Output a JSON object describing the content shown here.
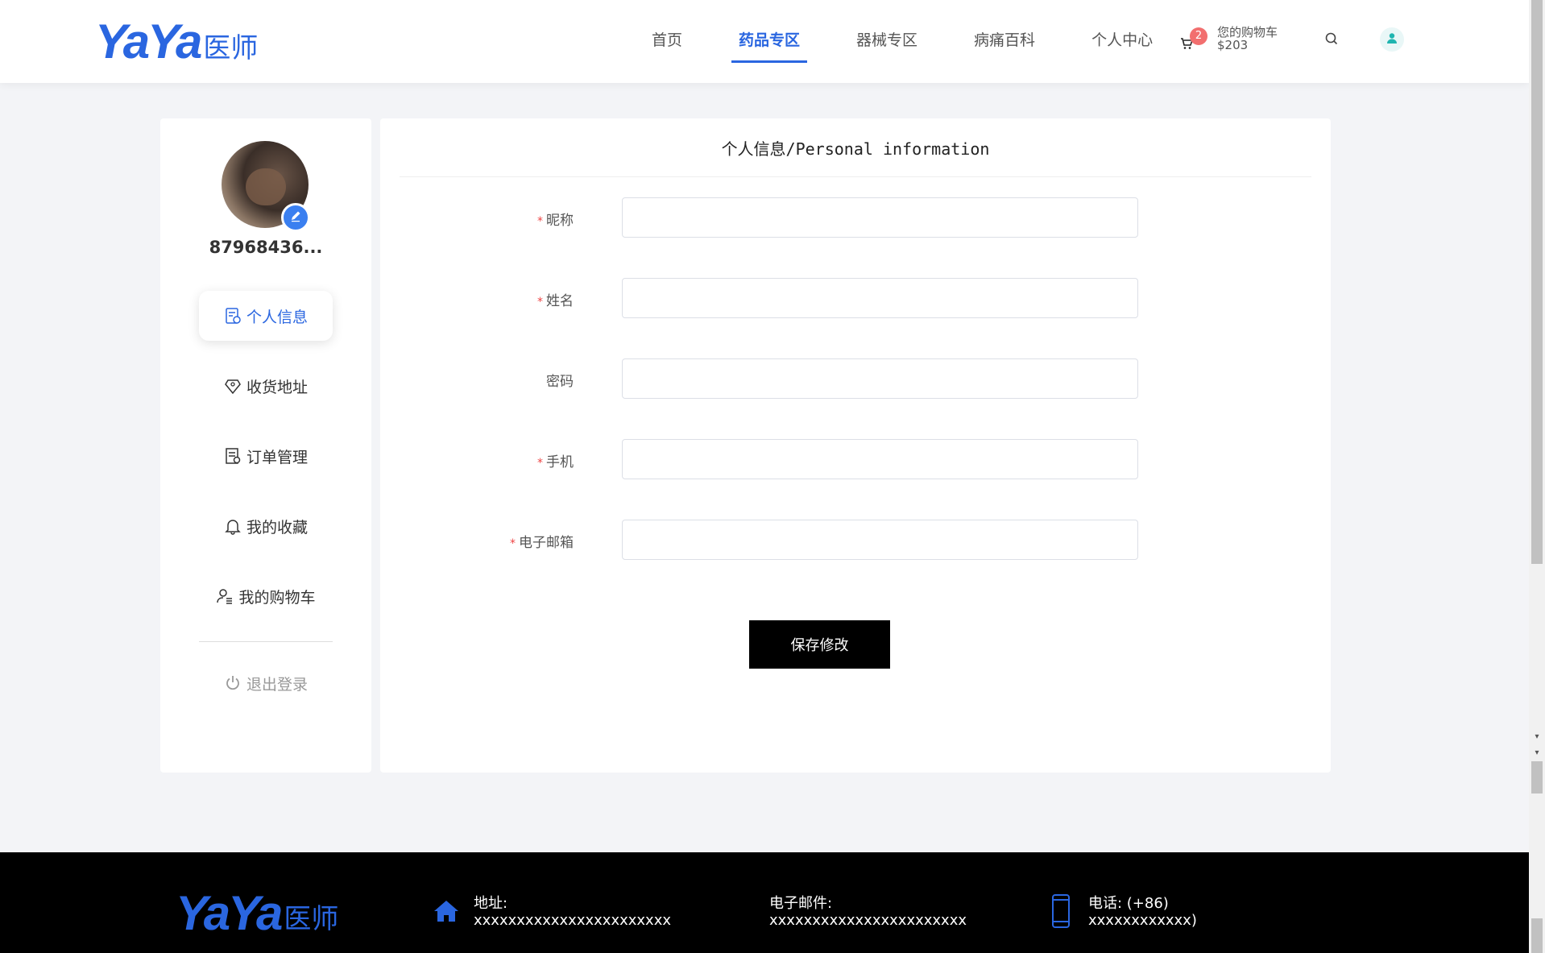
{
  "header": {
    "logo_latin": "YaYa",
    "logo_cn": "医师",
    "nav": [
      {
        "label": "首页"
      },
      {
        "label": "药品专区",
        "active": true
      },
      {
        "label": "器械专区"
      },
      {
        "label": "病痛百科"
      },
      {
        "label": "个人中心"
      }
    ],
    "cart": {
      "count": "2",
      "label": "您的购物车",
      "amount": "$203"
    }
  },
  "sidebar": {
    "username": "87968436...",
    "menu": [
      {
        "label": "个人信息",
        "icon": "profile-doc-icon",
        "active": true
      },
      {
        "label": "收货地址",
        "icon": "diamond-location-icon"
      },
      {
        "label": "订单管理",
        "icon": "order-list-icon"
      },
      {
        "label": "我的收藏",
        "icon": "bell-icon"
      },
      {
        "label": "我的购物车",
        "icon": "user-list-icon"
      }
    ],
    "logout": {
      "label": "退出登录",
      "icon": "power-icon"
    }
  },
  "panel": {
    "title": "个人信息/Personal information",
    "fields": [
      {
        "label": "昵称",
        "required": true,
        "value": "",
        "placeholder": ""
      },
      {
        "label": "姓名",
        "required": true,
        "value": "",
        "placeholder": ""
      },
      {
        "label": "密码",
        "required": false,
        "value": "",
        "placeholder": ""
      },
      {
        "label": "手机",
        "required": true,
        "value": "",
        "placeholder": ""
      },
      {
        "label": "电子邮箱",
        "required": true,
        "value": "",
        "placeholder": ""
      }
    ],
    "required_mark": "*",
    "save_label": "保存修改"
  },
  "footer": {
    "logo_latin": "YaYa",
    "logo_cn": "医师",
    "address": {
      "label": "地址:",
      "value": "xxxxxxxxxxxxxxxxxxxxxxx",
      "icon": "home-icon"
    },
    "email": {
      "label": "电子邮件:",
      "value": "xxxxxxxxxxxxxxxxxxxxxxx"
    },
    "phone": {
      "label": "电话: (+86)",
      "value": "xxxxxxxxxxxx)",
      "icon": "phone-icon"
    }
  },
  "colors": {
    "accent": "#2a66e0",
    "required": "#e44444",
    "badge": "#f26f6f"
  }
}
